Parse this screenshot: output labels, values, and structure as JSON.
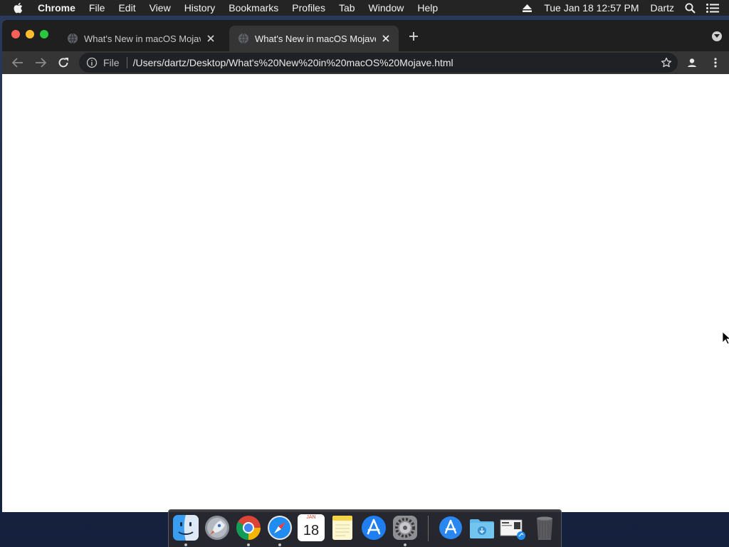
{
  "menubar": {
    "app_name": "Chrome",
    "items": [
      "File",
      "Edit",
      "View",
      "History",
      "Bookmarks",
      "Profiles",
      "Tab",
      "Window",
      "Help"
    ],
    "clock": "Tue Jan 18  12:57 PM",
    "user": "Dartz"
  },
  "tabs": [
    {
      "title": "What's New in macOS Mojave.h",
      "active": false
    },
    {
      "title": "What's New in macOS Mojave.h",
      "active": true
    }
  ],
  "omnibox": {
    "scheme_label": "File",
    "url": "/Users/dartz/Desktop/What's%20New%20in%20macOS%20Mojave.html"
  },
  "dock": {
    "apps": [
      "Finder",
      "Launchpad",
      "Google Chrome",
      "Safari",
      "Calendar",
      "Notes",
      "App Store",
      "System Preferences",
      "Applications",
      "Downloads",
      "Screenshot",
      "Trash"
    ],
    "calendar": {
      "month": "JAN",
      "day": "18"
    }
  },
  "colors": {
    "menubar_bg": "#242424",
    "titlebar_bg": "#1f1f1f",
    "toolbar_bg": "#353535",
    "omnibox_bg": "#202124",
    "close": "#fe5f57",
    "minimize": "#febc2e",
    "maximize": "#28c840"
  }
}
